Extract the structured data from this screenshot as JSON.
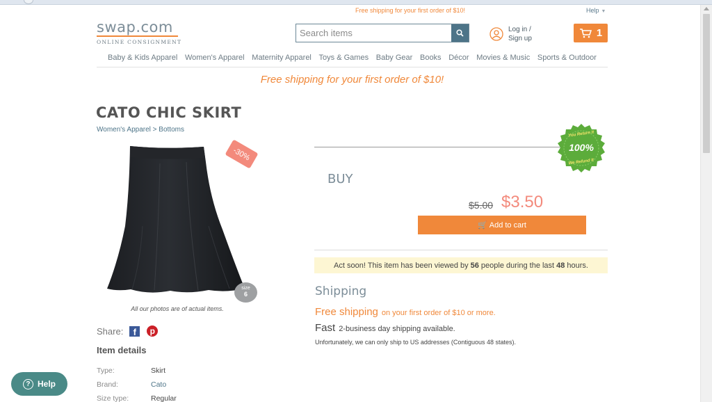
{
  "header": {
    "top_promo": "Free shipping for your first order of $10!",
    "help_link": "Help",
    "logo_name": "swap.com",
    "logo_tagline": "ONLINE CONSIGNMENT",
    "search_placeholder": "Search items",
    "login_line1": "Log in /",
    "login_line2": "Sign up",
    "cart_count": "1"
  },
  "nav": [
    "Baby & Kids Apparel",
    "Women's Apparel",
    "Maternity Apparel",
    "Toys & Games",
    "Baby Gear",
    "Books",
    "Décor",
    "Movies & Music",
    "Sports & Outdoor"
  ],
  "promo_banner": "Free shipping for your first order of $10!",
  "product": {
    "title": "CATO CHIC SKIRT",
    "breadcrumb": [
      "Women's Apparel",
      ">",
      "Bottoms"
    ],
    "discount": "-30%",
    "size_label": "size",
    "size_value": "6",
    "photo_caption": "All our photos are of actual items.",
    "share_label": "Share:",
    "details_heading": "Item details",
    "details": [
      {
        "key": "Type:",
        "value": "Skirt"
      },
      {
        "key": "Brand:",
        "value": "Cato"
      },
      {
        "key": "Size type:",
        "value": "Regular"
      }
    ]
  },
  "buy": {
    "label": "BUY",
    "old_price": "$5.00",
    "new_price": "$3.50",
    "add_to_cart": "Add to cart",
    "guarantee_top": "You Return It",
    "guarantee_mid": "100%",
    "guarantee_bottom": "We Refund It",
    "notice_prefix": "Act soon! This item has been viewed by",
    "notice_views": "56",
    "notice_mid": "people during the last",
    "notice_hours": "48",
    "notice_suffix": "hours."
  },
  "shipping": {
    "heading": "Shipping",
    "free_big": "Free shipping",
    "free_small": "on your first order of $10 or more.",
    "fast_big": "Fast",
    "fast_small": "2-business day shipping available.",
    "note": "Unfortunately, we can only ship to US addresses (Contiguous 48 states)."
  },
  "help_float": "Help",
  "colors": {
    "accent_orange": "#f0883a",
    "price_red": "#f38a7c",
    "link_teal": "#4d7488",
    "guarantee_green": "#5cac3b",
    "help_teal": "#4a8a87"
  }
}
